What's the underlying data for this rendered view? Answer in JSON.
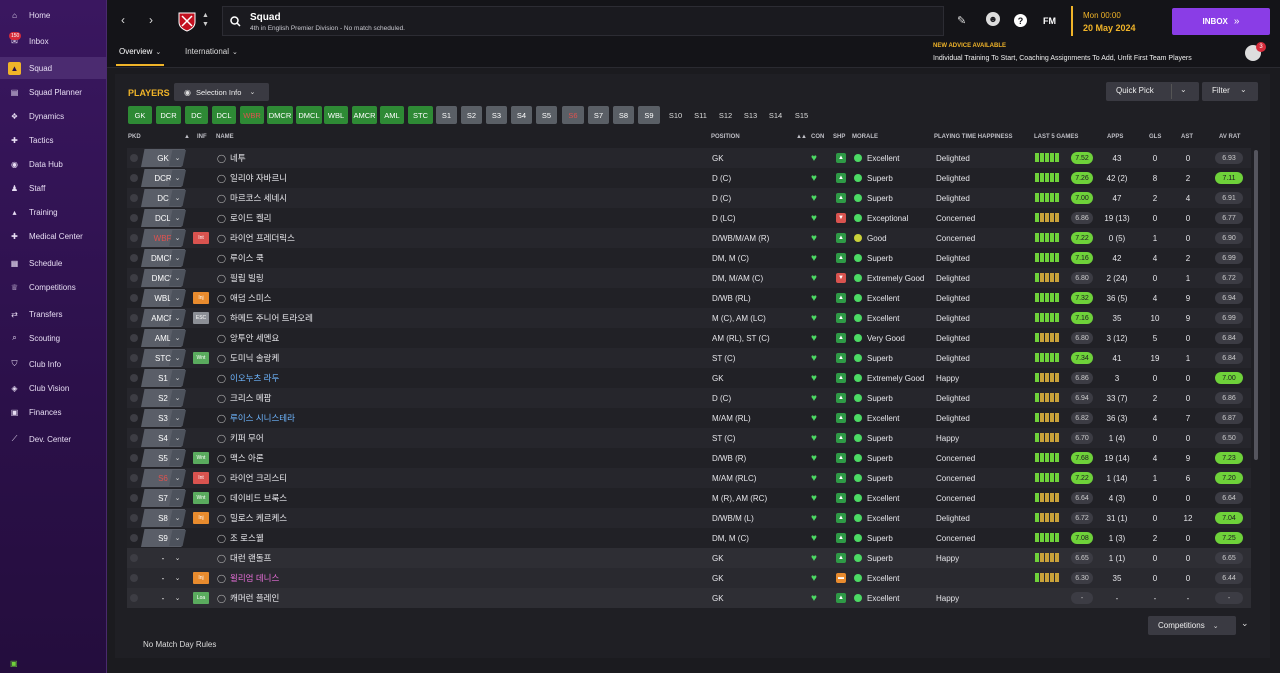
{
  "sidebar": {
    "items": [
      {
        "label": "Home",
        "icon": "home-icon"
      },
      {
        "label": "Inbox",
        "icon": "inbox-icon",
        "badge": "150"
      },
      {
        "label": "Squad",
        "icon": "shirt-icon"
      },
      {
        "label": "Squad Planner",
        "icon": "planner-icon"
      },
      {
        "label": "Dynamics",
        "icon": "dynamics-icon"
      },
      {
        "label": "Tactics",
        "icon": "tactics-icon"
      },
      {
        "label": "Data Hub",
        "icon": "datahub-icon"
      },
      {
        "label": "Staff",
        "icon": "staff-icon"
      },
      {
        "label": "Training",
        "icon": "training-icon"
      },
      {
        "label": "Medical Center",
        "icon": "medical-icon"
      },
      {
        "label": "Schedule",
        "icon": "schedule-icon"
      },
      {
        "label": "Competitions",
        "icon": "trophy-icon"
      },
      {
        "label": "Transfers",
        "icon": "transfers-icon"
      },
      {
        "label": "Scouting",
        "icon": "scouting-icon"
      },
      {
        "label": "Club Info",
        "icon": "shield-icon"
      },
      {
        "label": "Club Vision",
        "icon": "vision-icon"
      },
      {
        "label": "Finances",
        "icon": "finances-icon"
      },
      {
        "label": "Dev. Center",
        "icon": "devcenter-icon"
      }
    ]
  },
  "header": {
    "title": "Squad",
    "subtitle": "4th in English Premier Division - No match scheduled.",
    "fm": "FM",
    "time": "Mon 00:00",
    "date": "20 May 2024",
    "inbox_label": "INBOX",
    "advice_title": "NEW ADVICE AVAILABLE",
    "advice_text": "Individual Training To Start, Coaching Assignments To Add, Unfit First Team Players",
    "advice_count": "3"
  },
  "tabs": [
    {
      "label": "Overview"
    },
    {
      "label": "International"
    }
  ],
  "players_label": "PLAYERS",
  "selection_info": "Selection Info",
  "quick_pick": "Quick Pick",
  "filter": "Filter",
  "positions": [
    {
      "label": "GK",
      "t": "g"
    },
    {
      "label": "DCR",
      "t": "g"
    },
    {
      "label": "DC",
      "t": "g"
    },
    {
      "label": "DCL",
      "t": "g"
    },
    {
      "label": "WBR",
      "t": "g"
    },
    {
      "label": "DMCR",
      "t": "g"
    },
    {
      "label": "DMCL",
      "t": "g"
    },
    {
      "label": "WBL",
      "t": "g"
    },
    {
      "label": "AMCR",
      "t": "g"
    },
    {
      "label": "AML",
      "t": "g"
    },
    {
      "label": "STC",
      "t": "g"
    },
    {
      "label": "S1",
      "t": "s"
    },
    {
      "label": "S2",
      "t": "s"
    },
    {
      "label": "S3",
      "t": "s"
    },
    {
      "label": "S4",
      "t": "s"
    },
    {
      "label": "S5",
      "t": "s"
    },
    {
      "label": "S6",
      "t": "s"
    },
    {
      "label": "S7",
      "t": "s"
    },
    {
      "label": "S8",
      "t": "s"
    },
    {
      "label": "S9",
      "t": "s"
    },
    {
      "label": "S10",
      "t": "d"
    },
    {
      "label": "S11",
      "t": "d"
    },
    {
      "label": "S12",
      "t": "d"
    },
    {
      "label": "S13",
      "t": "d"
    },
    {
      "label": "S14",
      "t": "d"
    },
    {
      "label": "S15",
      "t": "d"
    }
  ],
  "columns": {
    "pkd": "PKD",
    "inf": "INF",
    "name": "NAME",
    "position": "POSITION",
    "con": "CON",
    "shp": "SHP",
    "morale": "MORALE",
    "pth": "PLAYING TIME HAPPINESS",
    "last5": "LAST 5 GAMES",
    "apps": "APPS",
    "gls": "GLS",
    "ast": "AST",
    "avrat": "AV RAT"
  },
  "players": [
    {
      "pkd": "GK",
      "inf": "",
      "name": "네투",
      "pos": "GK",
      "morale": "Excellent",
      "happy": "Delighted",
      "form": "7.52",
      "fg": true,
      "apps": "43",
      "gls": "0",
      "ast": "0",
      "rat": "6.93",
      "rg": false,
      "shp": "up",
      "mc": "#4cd964"
    },
    {
      "pkd": "DCR",
      "inf": "",
      "name": "일리야 자바르니",
      "pos": "D (C)",
      "morale": "Superb",
      "happy": "Delighted",
      "form": "7.26",
      "fg": true,
      "apps": "42 (2)",
      "gls": "8",
      "ast": "2",
      "rat": "7.11",
      "rg": true,
      "shp": "up",
      "mc": "#4cd964"
    },
    {
      "pkd": "DC",
      "inf": "",
      "name": "마르코스 세네시",
      "pos": "D (C)",
      "morale": "Superb",
      "happy": "Delighted",
      "form": "7.00",
      "fg": true,
      "apps": "47",
      "gls": "2",
      "ast": "4",
      "rat": "6.91",
      "rg": false,
      "shp": "up",
      "mc": "#4cd964"
    },
    {
      "pkd": "DCL",
      "inf": "",
      "name": "로이드 켈리",
      "pos": "D (LC)",
      "morale": "Exceptional",
      "happy": "Concerned",
      "form": "6.86",
      "fg": false,
      "apps": "19 (13)",
      "gls": "0",
      "ast": "0",
      "rat": "6.77",
      "rg": false,
      "shp": "dn",
      "mc": "#4cd964"
    },
    {
      "pkd": "WBR",
      "inf": "Int",
      "name": "라이언 프레더릭스",
      "pos": "D/WB/M/AM (R)",
      "morale": "Good",
      "happy": "Concerned",
      "form": "7.22",
      "fg": true,
      "apps": "0 (5)",
      "gls": "1",
      "ast": "0",
      "rat": "6.90",
      "rg": false,
      "shp": "up",
      "mc": "#c9d13a"
    },
    {
      "pkd": "DMCR",
      "inf": "",
      "name": "루이스 쿡",
      "pos": "DM, M (C)",
      "morale": "Superb",
      "happy": "Delighted",
      "form": "7.16",
      "fg": true,
      "apps": "42",
      "gls": "4",
      "ast": "2",
      "rat": "6.99",
      "rg": false,
      "shp": "up",
      "mc": "#4cd964"
    },
    {
      "pkd": "DMCL",
      "inf": "",
      "name": "필립 빌링",
      "pos": "DM, M/AM (C)",
      "morale": "Extremely Good",
      "happy": "Delighted",
      "form": "6.80",
      "fg": false,
      "apps": "2 (24)",
      "gls": "0",
      "ast": "1",
      "rat": "6.72",
      "rg": false,
      "shp": "dn",
      "mc": "#4cd964"
    },
    {
      "pkd": "WBL",
      "inf": "Inj",
      "name": "애덤 스미스",
      "pos": "D/WB (RL)",
      "morale": "Excellent",
      "happy": "Delighted",
      "form": "7.32",
      "fg": true,
      "apps": "36 (5)",
      "gls": "4",
      "ast": "9",
      "rat": "6.94",
      "rg": false,
      "shp": "up",
      "mc": "#4cd964"
    },
    {
      "pkd": "AMCR",
      "inf": "ESC",
      "name": "하메드 주니어 트라오레",
      "pos": "M (C), AM (LC)",
      "morale": "Excellent",
      "happy": "Delighted",
      "form": "7.16",
      "fg": true,
      "apps": "35",
      "gls": "10",
      "ast": "9",
      "rat": "6.99",
      "rg": false,
      "shp": "up",
      "mc": "#4cd964"
    },
    {
      "pkd": "AML",
      "inf": "",
      "name": "앙투안 세멘요",
      "pos": "AM (RL), ST (C)",
      "morale": "Very Good",
      "happy": "Delighted",
      "form": "6.80",
      "fg": false,
      "apps": "3 (12)",
      "gls": "5",
      "ast": "0",
      "rat": "6.84",
      "rg": false,
      "shp": "up",
      "mc": "#4cd964"
    },
    {
      "pkd": "STC",
      "inf": "Wnt",
      "name": "도미닉 솔랑케",
      "pos": "ST (C)",
      "morale": "Superb",
      "happy": "Delighted",
      "form": "7.34",
      "fg": true,
      "apps": "41",
      "gls": "19",
      "ast": "1",
      "rat": "6.84",
      "rg": false,
      "shp": "up",
      "mc": "#4cd964"
    },
    {
      "pkd": "S1",
      "inf": "",
      "name": "이오누츠 라두",
      "pos": "GK",
      "morale": "Extremely Good",
      "happy": "Happy",
      "form": "6.86",
      "fg": false,
      "apps": "3",
      "gls": "0",
      "ast": "0",
      "rat": "7.00",
      "rg": true,
      "shp": "up",
      "mc": "#4cd964",
      "blue": true
    },
    {
      "pkd": "S2",
      "inf": "",
      "name": "크리스 메팜",
      "pos": "D (C)",
      "morale": "Superb",
      "happy": "Delighted",
      "form": "6.94",
      "fg": false,
      "apps": "33 (7)",
      "gls": "2",
      "ast": "0",
      "rat": "6.86",
      "rg": false,
      "shp": "up",
      "mc": "#4cd964"
    },
    {
      "pkd": "S3",
      "inf": "",
      "name": "루이스 시니스테라",
      "pos": "M/AM (RL)",
      "morale": "Excellent",
      "happy": "Delighted",
      "form": "6.82",
      "fg": false,
      "apps": "36 (3)",
      "gls": "4",
      "ast": "7",
      "rat": "6.87",
      "rg": false,
      "shp": "up",
      "mc": "#4cd964",
      "blue": true
    },
    {
      "pkd": "S4",
      "inf": "",
      "name": "키퍼 무어",
      "pos": "ST (C)",
      "morale": "Superb",
      "happy": "Happy",
      "form": "6.70",
      "fg": false,
      "apps": "1 (4)",
      "gls": "0",
      "ast": "0",
      "rat": "6.50",
      "rg": false,
      "shp": "up",
      "mc": "#4cd964"
    },
    {
      "pkd": "S5",
      "inf": "Wnt",
      "name": "맥스 아론",
      "pos": "D/WB (R)",
      "morale": "Superb",
      "happy": "Concerned",
      "form": "7.68",
      "fg": true,
      "apps": "19 (14)",
      "gls": "4",
      "ast": "9",
      "rat": "7.23",
      "rg": true,
      "shp": "up",
      "mc": "#4cd964"
    },
    {
      "pkd": "S6",
      "inf": "Int",
      "name": "라이언 크리스티",
      "pos": "M/AM (RLC)",
      "morale": "Superb",
      "happy": "Concerned",
      "form": "7.22",
      "fg": true,
      "apps": "1 (14)",
      "gls": "1",
      "ast": "6",
      "rat": "7.20",
      "rg": true,
      "shp": "up",
      "mc": "#4cd964"
    },
    {
      "pkd": "S7",
      "inf": "Wnt",
      "name": "데이비드 브룩스",
      "pos": "M (R), AM (RC)",
      "morale": "Excellent",
      "happy": "Concerned",
      "form": "6.64",
      "fg": false,
      "apps": "4 (3)",
      "gls": "0",
      "ast": "0",
      "rat": "6.64",
      "rg": false,
      "shp": "up",
      "mc": "#4cd964"
    },
    {
      "pkd": "S8",
      "inf": "Inj",
      "name": "밀로스 케르케스",
      "pos": "D/WB/M (L)",
      "morale": "Excellent",
      "happy": "Delighted",
      "form": "6.72",
      "fg": false,
      "apps": "31 (1)",
      "gls": "0",
      "ast": "12",
      "rat": "7.04",
      "rg": true,
      "shp": "up",
      "mc": "#4cd964"
    },
    {
      "pkd": "S9",
      "inf": "",
      "name": "조 로스웰",
      "pos": "DM, M (C)",
      "morale": "Superb",
      "happy": "Concerned",
      "form": "7.08",
      "fg": true,
      "apps": "1 (3)",
      "gls": "2",
      "ast": "0",
      "rat": "7.25",
      "rg": true,
      "shp": "up",
      "mc": "#4cd964"
    },
    {
      "pkd": "-",
      "inf": "",
      "name": "대런 랜돌프",
      "pos": "GK",
      "morale": "Superb",
      "happy": "Happy",
      "form": "6.65",
      "fg": false,
      "apps": "1 (1)",
      "gls": "0",
      "ast": "0",
      "rat": "6.65",
      "rg": false,
      "shp": "up",
      "mc": "#4cd964",
      "reserve": true
    },
    {
      "pkd": "-",
      "inf": "Inj",
      "name": "윌리엄 데니스",
      "pos": "GK",
      "morale": "Excellent",
      "happy": "",
      "form": "6.30",
      "fg": false,
      "apps": "35",
      "gls": "0",
      "ast": "0",
      "rat": "6.44",
      "rg": false,
      "shp": "mid",
      "mc": "#4cd964",
      "reserve": true,
      "pink": true
    },
    {
      "pkd": "-",
      "inf": "Loa",
      "name": "캐머런 플레인",
      "pos": "GK",
      "morale": "Excellent",
      "happy": "Happy",
      "form": "-",
      "fg": false,
      "apps": "-",
      "gls": "-",
      "ast": "-",
      "rat": "-",
      "rg": false,
      "shp": "up",
      "mc": "#4cd964",
      "reserve": true
    }
  ],
  "competitions": "Competitions",
  "no_match_rules": "No Match Day Rules"
}
